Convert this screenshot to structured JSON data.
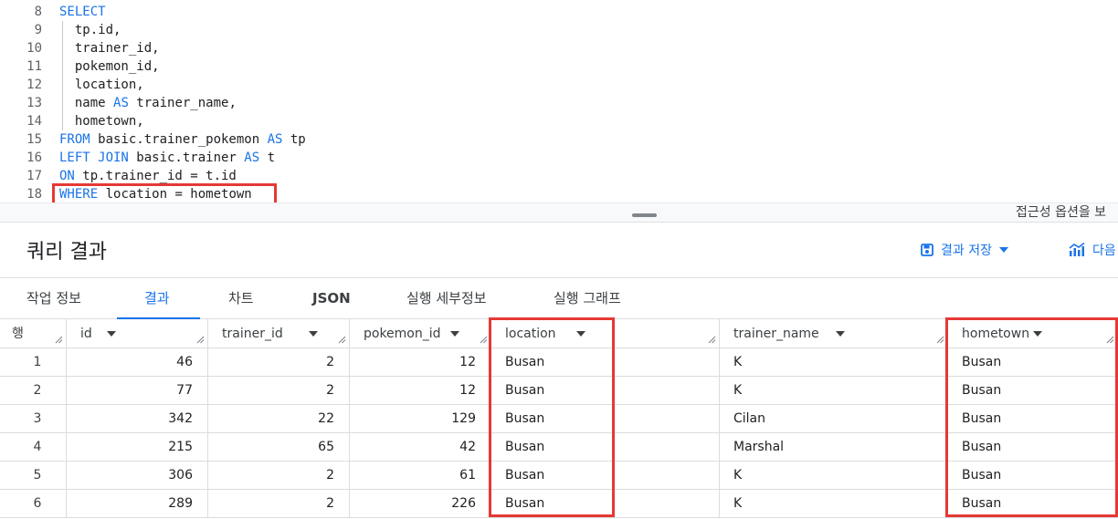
{
  "editor": {
    "lines": [
      {
        "n": "8",
        "parts": [
          {
            "t": "SELECT",
            "k": true
          }
        ]
      },
      {
        "n": "9",
        "parts": [
          {
            "t": "  tp.id,",
            "k": false
          }
        ]
      },
      {
        "n": "10",
        "parts": [
          {
            "t": "  trainer_id,",
            "k": false
          }
        ]
      },
      {
        "n": "11",
        "parts": [
          {
            "t": "  pokemon_id,",
            "k": false
          }
        ]
      },
      {
        "n": "12",
        "parts": [
          {
            "t": "  location,",
            "k": false
          }
        ]
      },
      {
        "n": "13",
        "parts": [
          {
            "t": "  name ",
            "k": false
          },
          {
            "t": "AS",
            "k": true
          },
          {
            "t": " trainer_name,",
            "k": false
          }
        ]
      },
      {
        "n": "14",
        "parts": [
          {
            "t": "  hometown,",
            "k": false
          }
        ]
      },
      {
        "n": "15",
        "parts": [
          {
            "t": "FROM",
            "k": true
          },
          {
            "t": " basic.trainer_pokemon ",
            "k": false
          },
          {
            "t": "AS",
            "k": true
          },
          {
            "t": " tp",
            "k": false
          }
        ]
      },
      {
        "n": "16",
        "parts": [
          {
            "t": "LEFT JOIN",
            "k": true
          },
          {
            "t": " basic.trainer ",
            "k": false
          },
          {
            "t": "AS",
            "k": true
          },
          {
            "t": " t",
            "k": false
          }
        ]
      },
      {
        "n": "17",
        "parts": [
          {
            "t": "ON",
            "k": true
          },
          {
            "t": " tp.trainer_id = t.id",
            "k": false
          }
        ]
      },
      {
        "n": "18",
        "parts": [
          {
            "t": "WHERE",
            "k": true
          },
          {
            "t": " location = hometown",
            "k": false
          }
        ]
      }
    ],
    "accessibility_hint": "접근성 옵션을 보"
  },
  "results": {
    "title": "쿼리 결과",
    "save_label": "결과 저장",
    "explore_label": "다음",
    "tabs": [
      "작업 정보",
      "결과",
      "차트",
      "JSON",
      "실행 세부정보",
      "실행 그래프"
    ],
    "active_tab": "결과",
    "columns": [
      "행",
      "id",
      "trainer_id",
      "pokemon_id",
      "location",
      "trainer_name",
      "hometown"
    ],
    "rows": [
      [
        "1",
        "46",
        "2",
        "12",
        "Busan",
        "K",
        "Busan"
      ],
      [
        "2",
        "77",
        "2",
        "12",
        "Busan",
        "K",
        "Busan"
      ],
      [
        "3",
        "342",
        "22",
        "129",
        "Busan",
        "Cilan",
        "Busan"
      ],
      [
        "4",
        "215",
        "65",
        "42",
        "Busan",
        "Marshal",
        "Busan"
      ],
      [
        "5",
        "306",
        "2",
        "61",
        "Busan",
        "K",
        "Busan"
      ],
      [
        "6",
        "289",
        "2",
        "226",
        "Busan",
        "K",
        "Busan"
      ]
    ],
    "highlighted_columns": [
      "location",
      "hometown"
    ]
  },
  "colors": {
    "accent": "#1a73e8",
    "highlight": "#e53935"
  }
}
